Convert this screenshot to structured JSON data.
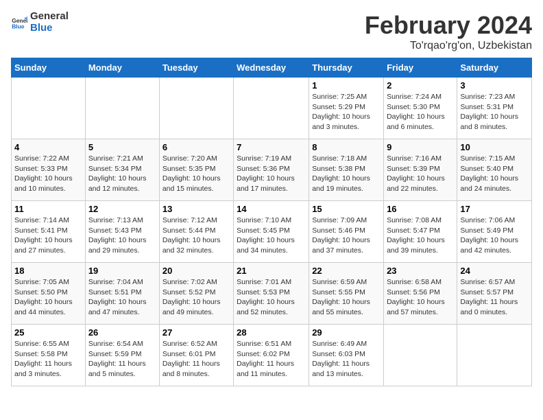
{
  "logo": {
    "line1": "General",
    "line2": "Blue"
  },
  "title": "February 2024",
  "subtitle": "To'rqao'rg'on, Uzbekistan",
  "weekdays": [
    "Sunday",
    "Monday",
    "Tuesday",
    "Wednesday",
    "Thursday",
    "Friday",
    "Saturday"
  ],
  "weeks": [
    [
      {
        "day": "",
        "sunrise": "",
        "sunset": "",
        "daylight": ""
      },
      {
        "day": "",
        "sunrise": "",
        "sunset": "",
        "daylight": ""
      },
      {
        "day": "",
        "sunrise": "",
        "sunset": "",
        "daylight": ""
      },
      {
        "day": "",
        "sunrise": "",
        "sunset": "",
        "daylight": ""
      },
      {
        "day": "1",
        "sunrise": "7:25 AM",
        "sunset": "5:29 PM",
        "daylight": "10 hours and 3 minutes."
      },
      {
        "day": "2",
        "sunrise": "7:24 AM",
        "sunset": "5:30 PM",
        "daylight": "10 hours and 6 minutes."
      },
      {
        "day": "3",
        "sunrise": "7:23 AM",
        "sunset": "5:31 PM",
        "daylight": "10 hours and 8 minutes."
      }
    ],
    [
      {
        "day": "4",
        "sunrise": "7:22 AM",
        "sunset": "5:33 PM",
        "daylight": "10 hours and 10 minutes."
      },
      {
        "day": "5",
        "sunrise": "7:21 AM",
        "sunset": "5:34 PM",
        "daylight": "10 hours and 12 minutes."
      },
      {
        "day": "6",
        "sunrise": "7:20 AM",
        "sunset": "5:35 PM",
        "daylight": "10 hours and 15 minutes."
      },
      {
        "day": "7",
        "sunrise": "7:19 AM",
        "sunset": "5:36 PM",
        "daylight": "10 hours and 17 minutes."
      },
      {
        "day": "8",
        "sunrise": "7:18 AM",
        "sunset": "5:38 PM",
        "daylight": "10 hours and 19 minutes."
      },
      {
        "day": "9",
        "sunrise": "7:16 AM",
        "sunset": "5:39 PM",
        "daylight": "10 hours and 22 minutes."
      },
      {
        "day": "10",
        "sunrise": "7:15 AM",
        "sunset": "5:40 PM",
        "daylight": "10 hours and 24 minutes."
      }
    ],
    [
      {
        "day": "11",
        "sunrise": "7:14 AM",
        "sunset": "5:41 PM",
        "daylight": "10 hours and 27 minutes."
      },
      {
        "day": "12",
        "sunrise": "7:13 AM",
        "sunset": "5:43 PM",
        "daylight": "10 hours and 29 minutes."
      },
      {
        "day": "13",
        "sunrise": "7:12 AM",
        "sunset": "5:44 PM",
        "daylight": "10 hours and 32 minutes."
      },
      {
        "day": "14",
        "sunrise": "7:10 AM",
        "sunset": "5:45 PM",
        "daylight": "10 hours and 34 minutes."
      },
      {
        "day": "15",
        "sunrise": "7:09 AM",
        "sunset": "5:46 PM",
        "daylight": "10 hours and 37 minutes."
      },
      {
        "day": "16",
        "sunrise": "7:08 AM",
        "sunset": "5:47 PM",
        "daylight": "10 hours and 39 minutes."
      },
      {
        "day": "17",
        "sunrise": "7:06 AM",
        "sunset": "5:49 PM",
        "daylight": "10 hours and 42 minutes."
      }
    ],
    [
      {
        "day": "18",
        "sunrise": "7:05 AM",
        "sunset": "5:50 PM",
        "daylight": "10 hours and 44 minutes."
      },
      {
        "day": "19",
        "sunrise": "7:04 AM",
        "sunset": "5:51 PM",
        "daylight": "10 hours and 47 minutes."
      },
      {
        "day": "20",
        "sunrise": "7:02 AM",
        "sunset": "5:52 PM",
        "daylight": "10 hours and 49 minutes."
      },
      {
        "day": "21",
        "sunrise": "7:01 AM",
        "sunset": "5:53 PM",
        "daylight": "10 hours and 52 minutes."
      },
      {
        "day": "22",
        "sunrise": "6:59 AM",
        "sunset": "5:55 PM",
        "daylight": "10 hours and 55 minutes."
      },
      {
        "day": "23",
        "sunrise": "6:58 AM",
        "sunset": "5:56 PM",
        "daylight": "10 hours and 57 minutes."
      },
      {
        "day": "24",
        "sunrise": "6:57 AM",
        "sunset": "5:57 PM",
        "daylight": "11 hours and 0 minutes."
      }
    ],
    [
      {
        "day": "25",
        "sunrise": "6:55 AM",
        "sunset": "5:58 PM",
        "daylight": "11 hours and 3 minutes."
      },
      {
        "day": "26",
        "sunrise": "6:54 AM",
        "sunset": "5:59 PM",
        "daylight": "11 hours and 5 minutes."
      },
      {
        "day": "27",
        "sunrise": "6:52 AM",
        "sunset": "6:01 PM",
        "daylight": "11 hours and 8 minutes."
      },
      {
        "day": "28",
        "sunrise": "6:51 AM",
        "sunset": "6:02 PM",
        "daylight": "11 hours and 11 minutes."
      },
      {
        "day": "29",
        "sunrise": "6:49 AM",
        "sunset": "6:03 PM",
        "daylight": "11 hours and 13 minutes."
      },
      {
        "day": "",
        "sunrise": "",
        "sunset": "",
        "daylight": ""
      },
      {
        "day": "",
        "sunrise": "",
        "sunset": "",
        "daylight": ""
      }
    ]
  ],
  "labels": {
    "sunrise_prefix": "Sunrise: ",
    "sunset_prefix": "Sunset: ",
    "daylight_prefix": "Daylight: "
  }
}
